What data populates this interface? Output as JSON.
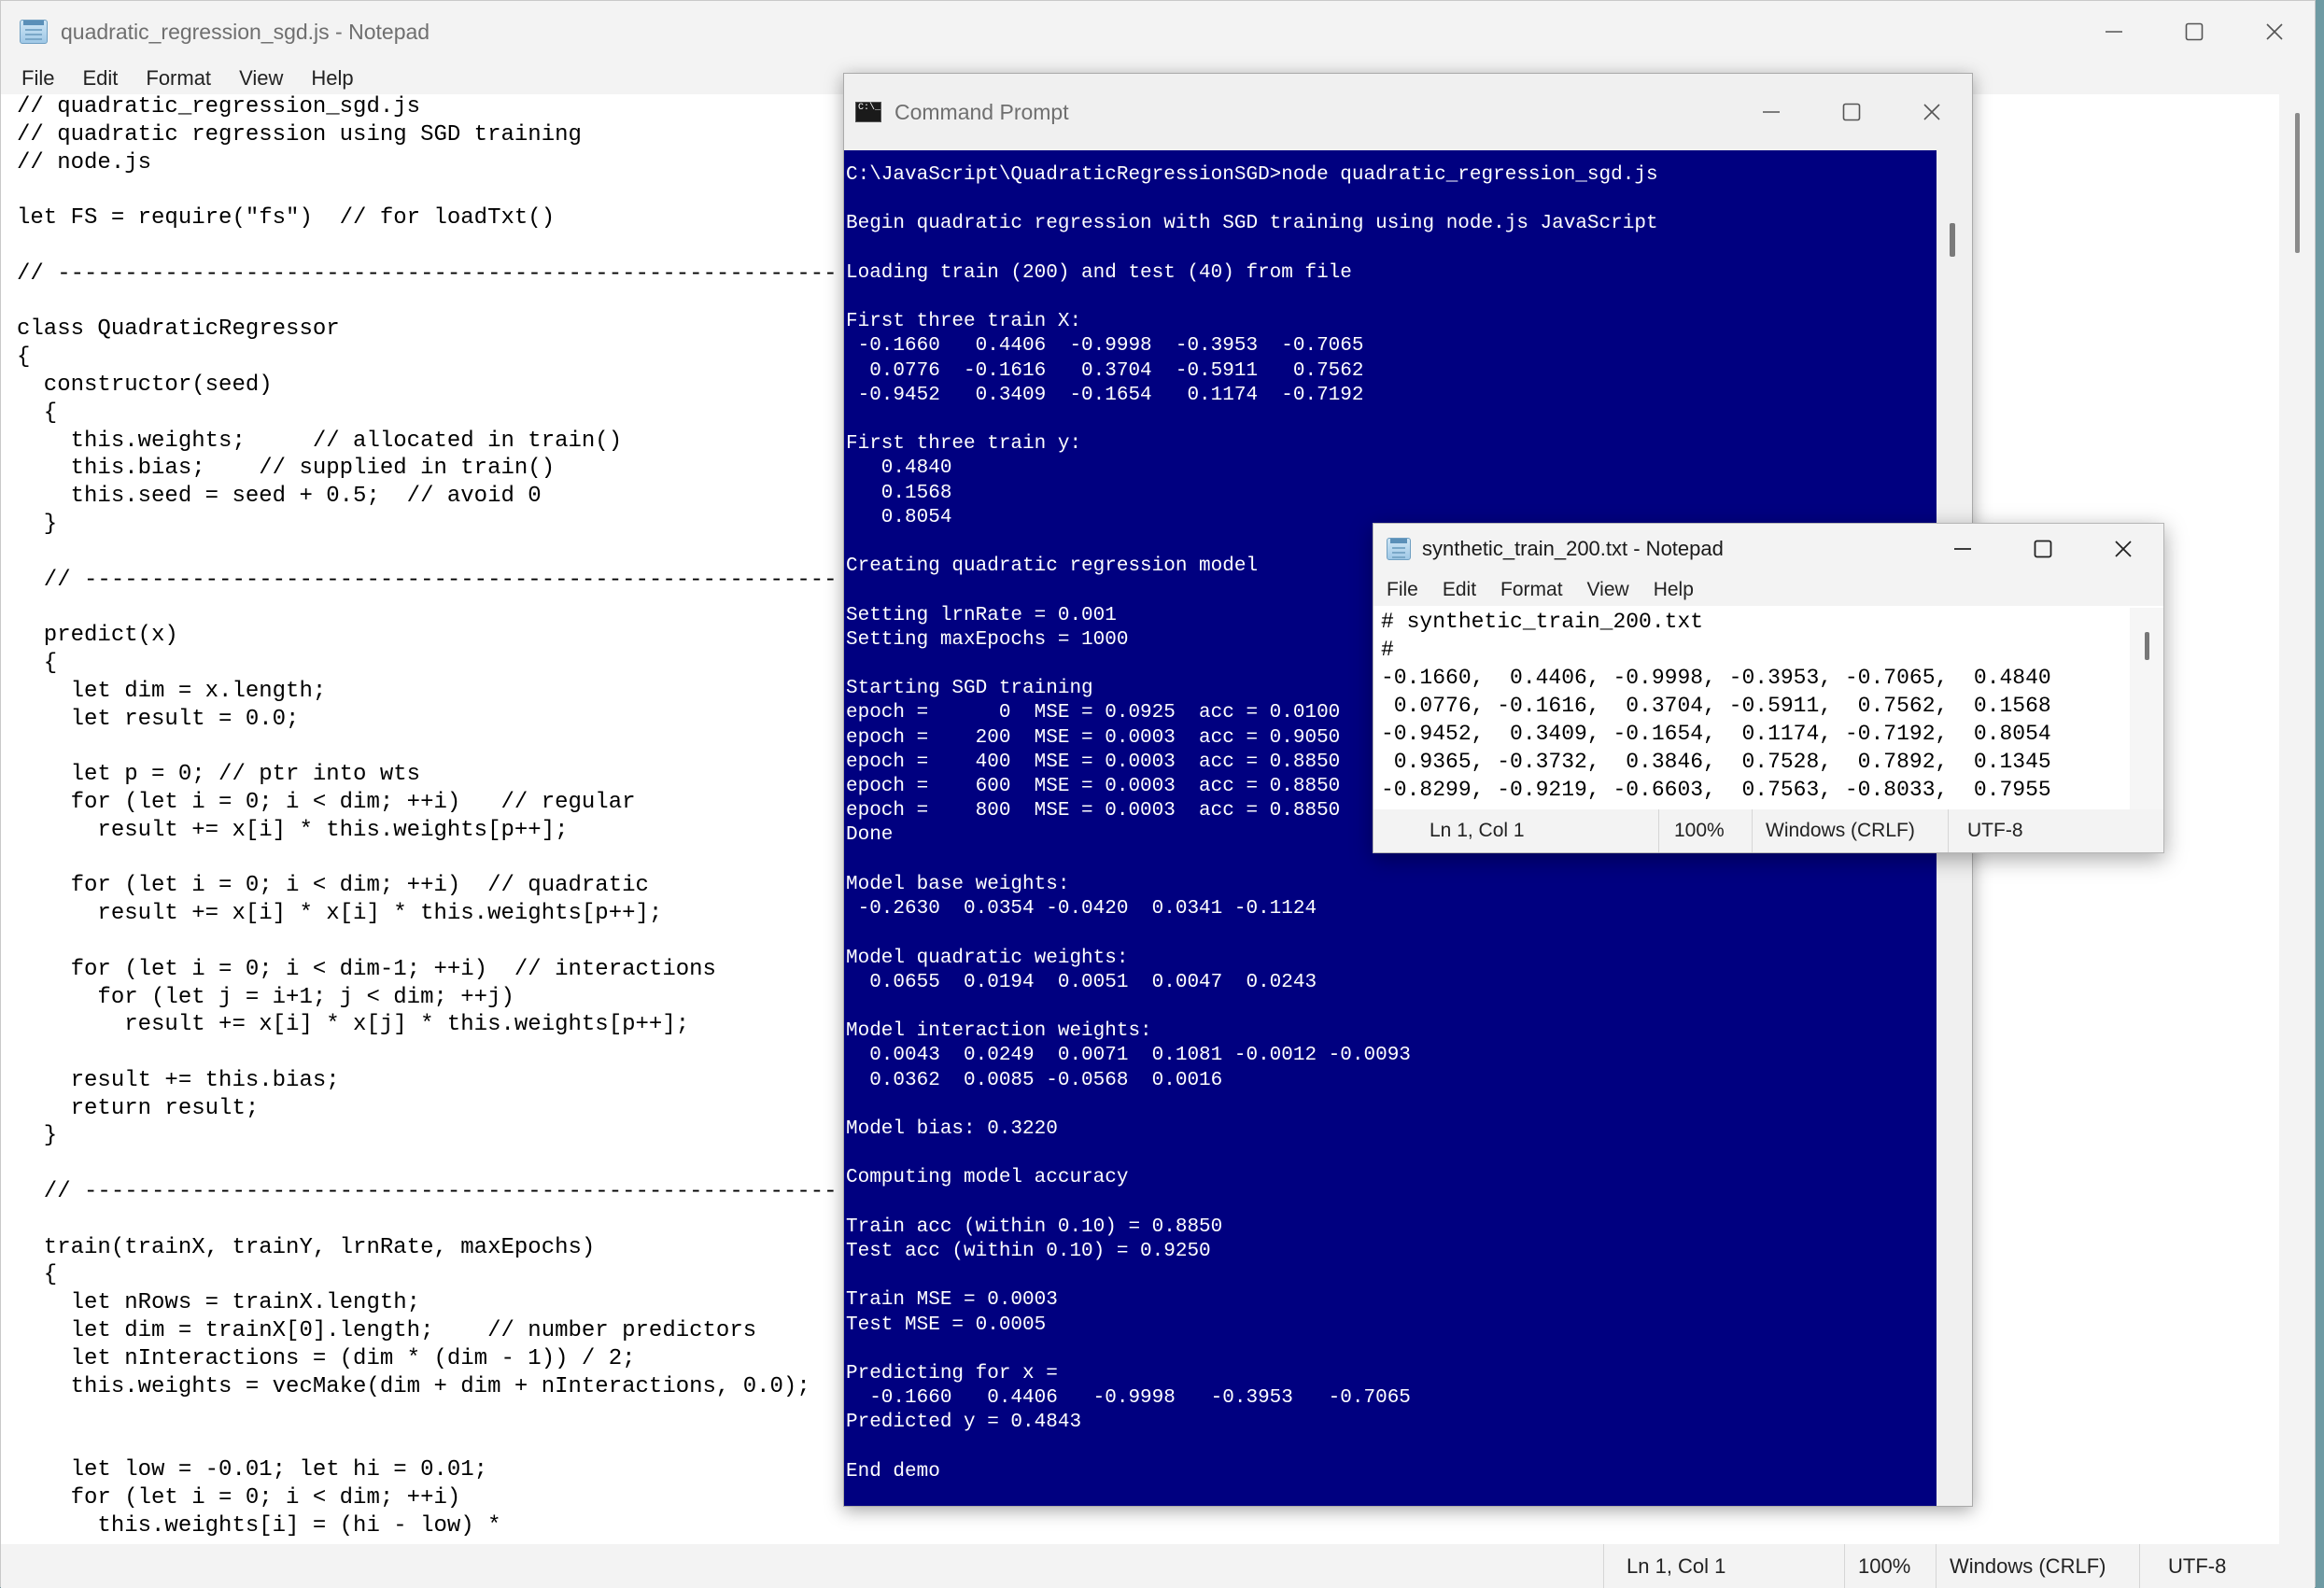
{
  "main_notepad": {
    "title": "quadratic_regression_sgd.js - Notepad",
    "menu": [
      "File",
      "Edit",
      "Format",
      "View",
      "Help"
    ],
    "code": "// quadratic_regression_sgd.js\n// quadratic regression using SGD training\n// node.js\n\nlet FS = require(\"fs\")  // for loadTxt()\n\n// ----------------------------------------------------------\n\nclass QuadraticRegressor\n{\n  constructor(seed)\n  {\n    this.weights;     // allocated in train()\n    this.bias;    // supplied in train()\n    this.seed = seed + 0.5;  // avoid 0\n  }\n\n  // --------------------------------------------------------\n\n  predict(x)\n  {\n    let dim = x.length;\n    let result = 0.0;\n\n    let p = 0; // ptr into wts\n    for (let i = 0; i < dim; ++i)   // regular\n      result += x[i] * this.weights[p++];\n\n    for (let i = 0; i < dim; ++i)  // quadratic\n      result += x[i] * x[i] * this.weights[p++];\n\n    for (let i = 0; i < dim-1; ++i)  // interactions\n      for (let j = i+1; j < dim; ++j)\n        result += x[i] * x[j] * this.weights[p++];\n\n    result += this.bias;\n    return result;\n  }\n\n  // --------------------------------------------------------\n\n  train(trainX, trainY, lrnRate, maxEpochs)\n  {\n    let nRows = trainX.length;\n    let dim = trainX[0].length;    // number predictors\n    let nInteractions = (dim * (dim - 1)) / 2;\n    this.weights = vecMake(dim + dim + nInteractions, 0.0);\n\n\n    let low = -0.01; let hi = 0.01;\n    for (let i = 0; i < dim; ++i)\n      this.weights[i] = (hi - low) *",
    "status": {
      "position": "Ln 1, Col 1",
      "zoom": "100%",
      "line_endings": "Windows (CRLF)",
      "encoding": "UTF-8"
    }
  },
  "command_prompt": {
    "title": "Command Prompt",
    "output": "C:\\JavaScript\\QuadraticRegressionSGD>node quadratic_regression_sgd.js\n\nBegin quadratic regression with SGD training using node.js JavaScript\n\nLoading train (200) and test (40) from file\n\nFirst three train X:\n -0.1660   0.4406  -0.9998  -0.3953  -0.7065\n  0.0776  -0.1616   0.3704  -0.5911   0.7562\n -0.9452   0.3409  -0.1654   0.1174  -0.7192\n\nFirst three train y:\n   0.4840\n   0.1568\n   0.8054\n\nCreating quadratic regression model\n\nSetting lrnRate = 0.001\nSetting maxEpochs = 1000\n\nStarting SGD training\nepoch =      0  MSE = 0.0925  acc = 0.0100\nepoch =    200  MSE = 0.0003  acc = 0.9050\nepoch =    400  MSE = 0.0003  acc = 0.8850\nepoch =    600  MSE = 0.0003  acc = 0.8850\nepoch =    800  MSE = 0.0003  acc = 0.8850\nDone\n\nModel base weights:\n -0.2630  0.0354 -0.0420  0.0341 -0.1124\n\nModel quadratic weights:\n  0.0655  0.0194  0.0051  0.0047  0.0243\n\nModel interaction weights:\n  0.0043  0.0249  0.0071  0.1081 -0.0012 -0.0093\n  0.0362  0.0085 -0.0568  0.0016\n\nModel bias: 0.3220\n\nComputing model accuracy\n\nTrain acc (within 0.10) = 0.8850\nTest acc (within 0.10) = 0.9250\n\nTrain MSE = 0.0003\nTest MSE = 0.0005\n\nPredicting for x =\n  -0.1660   0.4406   -0.9998   -0.3953   -0.7065\nPredicted y = 0.4843\n\nEnd demo"
  },
  "data_notepad": {
    "title": "synthetic_train_200.txt - Notepad",
    "menu": [
      "File",
      "Edit",
      "Format",
      "View",
      "Help"
    ],
    "content": "# synthetic_train_200.txt\n#\n-0.1660,  0.4406, -0.9998, -0.3953, -0.7065,  0.4840\n 0.0776, -0.1616,  0.3704, -0.5911,  0.7562,  0.1568\n-0.9452,  0.3409, -0.1654,  0.1174, -0.7192,  0.8054\n 0.9365, -0.3732,  0.3846,  0.7528,  0.7892,  0.1345\n-0.8299, -0.9219, -0.6603,  0.7563, -0.8033,  0.7955",
    "status": {
      "position": "Ln 1, Col 1",
      "zoom": "100%",
      "line_endings": "Windows (CRLF)",
      "encoding": "UTF-8"
    }
  }
}
